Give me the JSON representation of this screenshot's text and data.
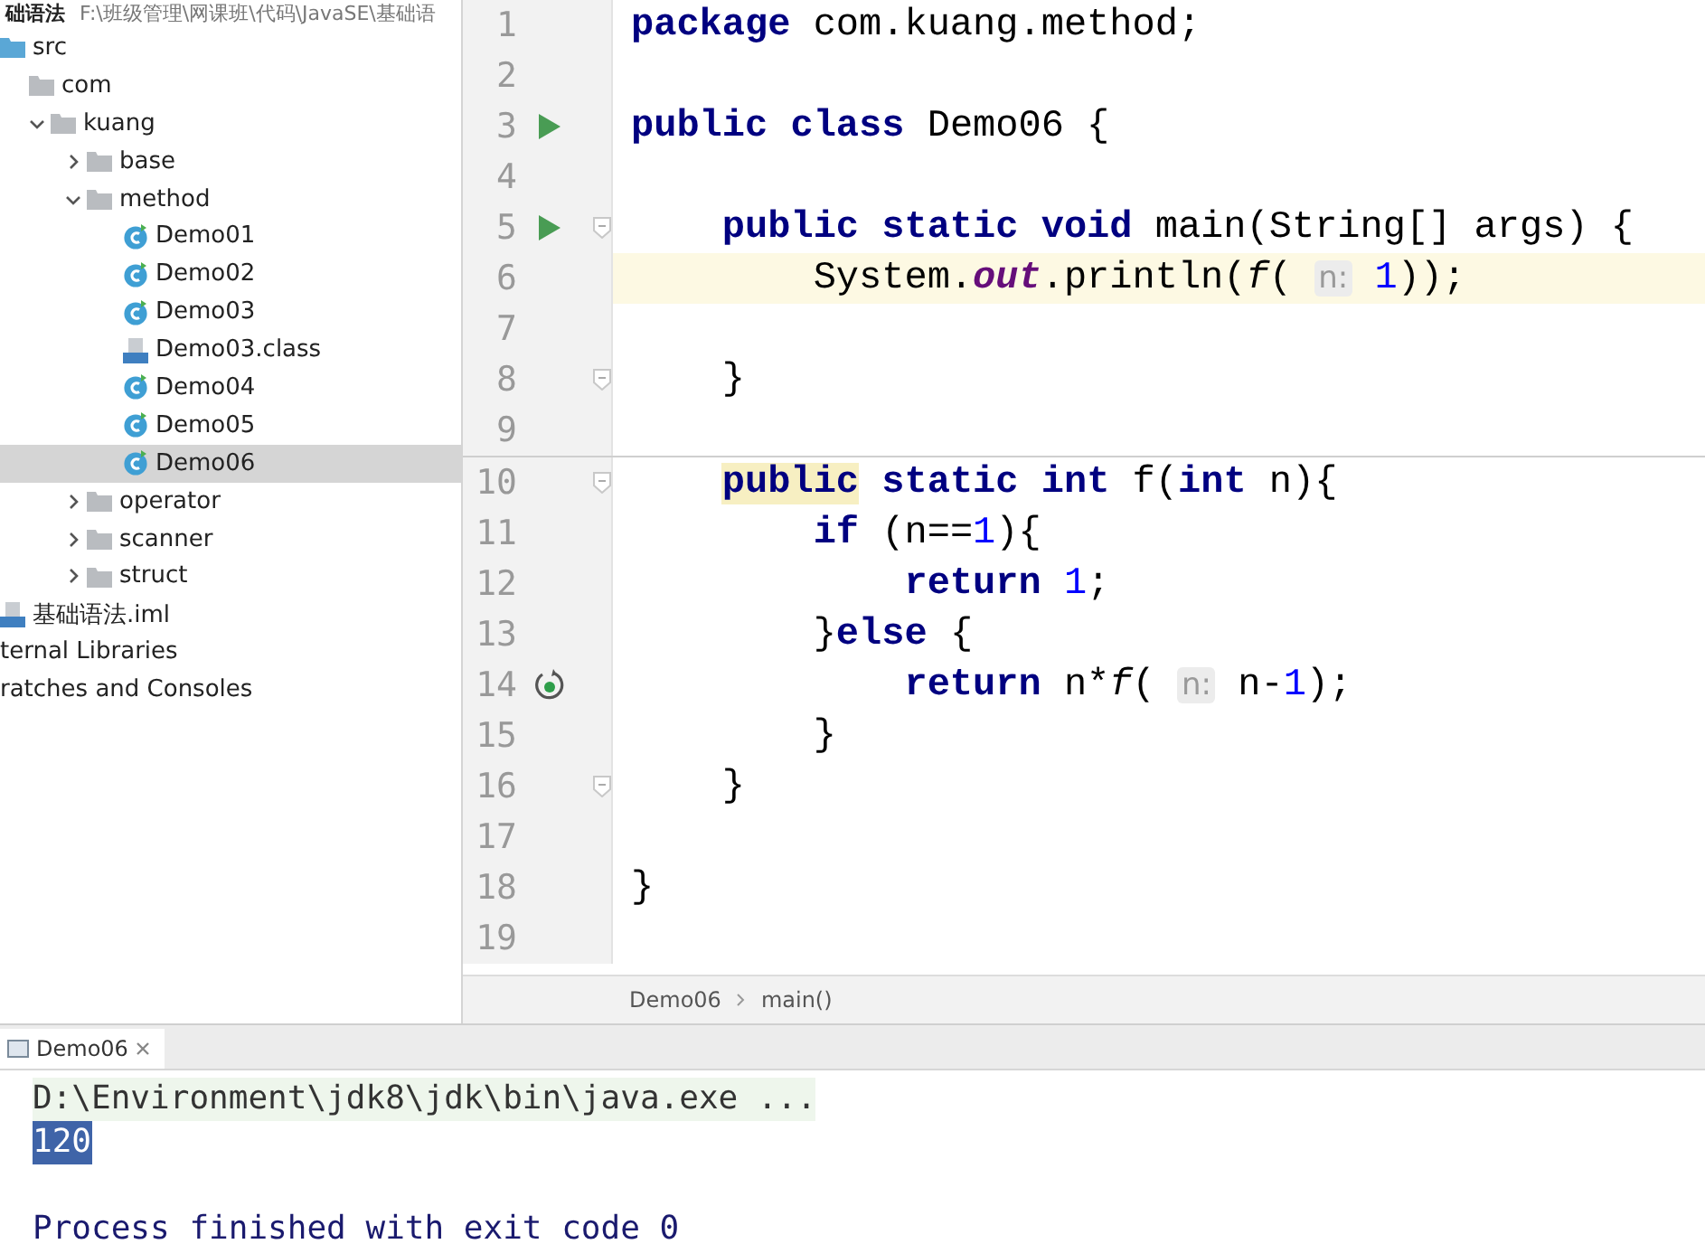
{
  "project_header": {
    "name": "础语法",
    "path": "F:\\班级管理\\网课班\\代码\\JavaSE\\基础语"
  },
  "project_tree": [
    {
      "label": "src",
      "kind": "source-folder",
      "selected": false,
      "children": [
        {
          "label": "com",
          "kind": "folder",
          "selected": false,
          "children": [
            {
              "label": "kuang",
              "kind": "folder",
              "expanded": true,
              "selected": false,
              "children": [
                {
                  "label": "base",
                  "kind": "folder",
                  "expanded": false,
                  "selected": false
                },
                {
                  "label": "method",
                  "kind": "folder",
                  "expanded": true,
                  "selected": false,
                  "children": [
                    {
                      "label": "Demo01",
                      "kind": "class",
                      "selected": false
                    },
                    {
                      "label": "Demo02",
                      "kind": "class",
                      "selected": false
                    },
                    {
                      "label": "Demo03",
                      "kind": "class",
                      "selected": false
                    },
                    {
                      "label": "Demo03.class",
                      "kind": "classfile",
                      "selected": false
                    },
                    {
                      "label": "Demo04",
                      "kind": "class",
                      "selected": false
                    },
                    {
                      "label": "Demo05",
                      "kind": "class",
                      "selected": false
                    },
                    {
                      "label": "Demo06",
                      "kind": "class",
                      "selected": true
                    }
                  ]
                },
                {
                  "label": "operator",
                  "kind": "folder",
                  "expanded": false,
                  "selected": false
                },
                {
                  "label": "scanner",
                  "kind": "folder",
                  "expanded": false,
                  "selected": false
                },
                {
                  "label": "struct",
                  "kind": "folder",
                  "expanded": false,
                  "selected": false
                }
              ]
            }
          ]
        }
      ]
    },
    {
      "label": "基础语法.iml",
      "kind": "module",
      "selected": false
    },
    {
      "label": "ternal Libraries",
      "kind": "plain",
      "selected": false
    },
    {
      "label": "ratches and Consoles",
      "kind": "plain",
      "selected": false
    }
  ],
  "editor": {
    "lines": [
      {
        "number": "1",
        "kind": "plain",
        "current": false,
        "separator": false,
        "fold": false,
        "tokens": [
          {
            "t": "package",
            "kind": "kw"
          },
          {
            "t": " com.kuang.method;",
            "kind": "plain"
          }
        ]
      },
      {
        "number": "2",
        "kind": "plain",
        "current": false,
        "separator": false,
        "fold": false
      },
      {
        "number": "3",
        "kind": "run",
        "current": false,
        "separator": false,
        "fold": false,
        "tokens": [
          {
            "t": "public class",
            "kind": "kw"
          },
          {
            "t": " Demo06 {",
            "kind": "plain"
          }
        ]
      },
      {
        "number": "4",
        "kind": "plain",
        "current": false,
        "separator": false,
        "fold": false
      },
      {
        "number": "5",
        "kind": "run",
        "current": false,
        "separator": false,
        "fold": true,
        "tokens": [
          {
            "t": "    public static void",
            "kind": "kw"
          },
          {
            "t": " main(String[] args) {",
            "kind": "plain"
          }
        ]
      },
      {
        "number": "6",
        "kind": "plain",
        "current": true,
        "separator": false,
        "fold": false,
        "tokens": [
          {
            "t": "        System.",
            "kind": "plain"
          },
          {
            "t": "out",
            "kind": "static"
          },
          {
            "t": ".println(",
            "kind": "plain"
          },
          {
            "t": "f",
            "kind": "call"
          },
          {
            "t": "( ",
            "kind": "plain"
          },
          {
            "t": "n:",
            "kind": "hint"
          },
          {
            "t": " 1",
            "kind": "num"
          },
          {
            "t": "));",
            "kind": "plain"
          }
        ]
      },
      {
        "number": "7",
        "kind": "plain",
        "current": false,
        "separator": false,
        "fold": false
      },
      {
        "number": "8",
        "kind": "plain",
        "current": false,
        "separator": false,
        "fold": true,
        "tokens": [
          {
            "t": "    }",
            "kind": "plain"
          }
        ]
      },
      {
        "number": "9",
        "kind": "plain",
        "current": false,
        "separator": false,
        "fold": false
      },
      {
        "number": "10",
        "kind": "plain",
        "current": false,
        "separator": true,
        "fold": true,
        "tokens": [
          {
            "t": "    public",
            "kind": "kw",
            "highlighted": true
          },
          {
            "t": " static int",
            "kind": "kw"
          },
          {
            "t": " f(",
            "kind": "plain"
          },
          {
            "t": "int",
            "kind": "kw"
          },
          {
            "t": " n){",
            "kind": "plain"
          }
        ]
      },
      {
        "number": "11",
        "kind": "plain",
        "current": false,
        "separator": false,
        "fold": false,
        "tokens": [
          {
            "t": "        if",
            "kind": "kw"
          },
          {
            "t": " (n==",
            "kind": "plain"
          },
          {
            "t": "1",
            "kind": "num"
          },
          {
            "t": "){",
            "kind": "plain"
          }
        ]
      },
      {
        "number": "12",
        "kind": "plain",
        "current": false,
        "separator": false,
        "fold": false,
        "tokens": [
          {
            "t": "            return",
            "kind": "kw"
          },
          {
            "t": " 1",
            "kind": "num"
          },
          {
            "t": ";",
            "kind": "plain"
          }
        ]
      },
      {
        "number": "13",
        "kind": "plain",
        "current": false,
        "separator": false,
        "fold": false,
        "tokens": [
          {
            "t": "        }",
            "kind": "plain"
          },
          {
            "t": "else",
            "kind": "kw"
          },
          {
            "t": " {",
            "kind": "plain"
          }
        ]
      },
      {
        "number": "14",
        "kind": "recursion",
        "current": false,
        "separator": false,
        "fold": false,
        "tokens": [
          {
            "t": "            return",
            "kind": "kw"
          },
          {
            "t": " n*",
            "kind": "plain"
          },
          {
            "t": "f",
            "kind": "call"
          },
          {
            "t": "( ",
            "kind": "plain"
          },
          {
            "t": "n:",
            "kind": "hint"
          },
          {
            "t": " n-",
            "kind": "plain"
          },
          {
            "t": "1",
            "kind": "num"
          },
          {
            "t": ");",
            "kind": "plain"
          }
        ]
      },
      {
        "number": "15",
        "kind": "plain",
        "current": false,
        "separator": false,
        "fold": false,
        "tokens": [
          {
            "t": "        }",
            "kind": "plain"
          }
        ]
      },
      {
        "number": "16",
        "kind": "plain",
        "current": false,
        "separator": false,
        "fold": true,
        "tokens": [
          {
            "t": "    }",
            "kind": "plain"
          }
        ]
      },
      {
        "number": "17",
        "kind": "plain",
        "current": false,
        "separator": false,
        "fold": false
      },
      {
        "number": "18",
        "kind": "plain",
        "current": false,
        "separator": false,
        "fold": false,
        "tokens": [
          {
            "t": "}",
            "kind": "plain"
          }
        ]
      },
      {
        "number": "19",
        "kind": "plain",
        "current": false,
        "separator": false,
        "fold": false
      }
    ],
    "breadcrumbs": [
      "Demo06",
      "main()"
    ]
  },
  "run_panel": {
    "tabs": [
      {
        "label": "Demo06",
        "selected": true
      }
    ],
    "console": [
      {
        "kind": "command",
        "text": "D:\\Environment\\jdk8\\jdk\\bin\\java.exe ...",
        "selected": false
      },
      {
        "kind": "output",
        "text": "120",
        "selected": true
      },
      {
        "kind": "blank"
      },
      {
        "kind": "exit",
        "text": "Process finished with exit code 0",
        "selected": false
      }
    ]
  }
}
